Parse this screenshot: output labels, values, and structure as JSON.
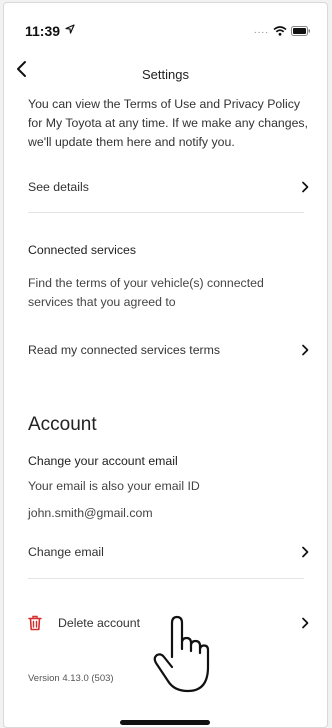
{
  "status_bar": {
    "time": "11:39",
    "dots": "...."
  },
  "nav": {
    "title": "Settings"
  },
  "terms": {
    "description": "You can view the Terms of Use and Privacy Policy for My Toyota at any time. If we make any changes, we'll update them here and notify you.",
    "see_details": "See details"
  },
  "connected": {
    "heading": "Connected services",
    "description": "Find the terms of your vehicle(s) connected services that you agreed to",
    "read_terms": "Read my connected services terms"
  },
  "account": {
    "title": "Account",
    "change_email_heading": "Change your account email",
    "email_note": "Your email is also your email ID",
    "email": "john.smith@gmail.com",
    "change_email": "Change email",
    "delete_account": "Delete account"
  },
  "version": "Version 4.13.0 (503)",
  "colors": {
    "delete_icon": "#d32f2f",
    "text": "#333333"
  },
  "icons": [
    "back-chevron-icon",
    "location-arrow-icon",
    "wifi-icon",
    "battery-icon",
    "chevron-right-icon",
    "trash-icon",
    "hand-pointer-icon"
  ]
}
